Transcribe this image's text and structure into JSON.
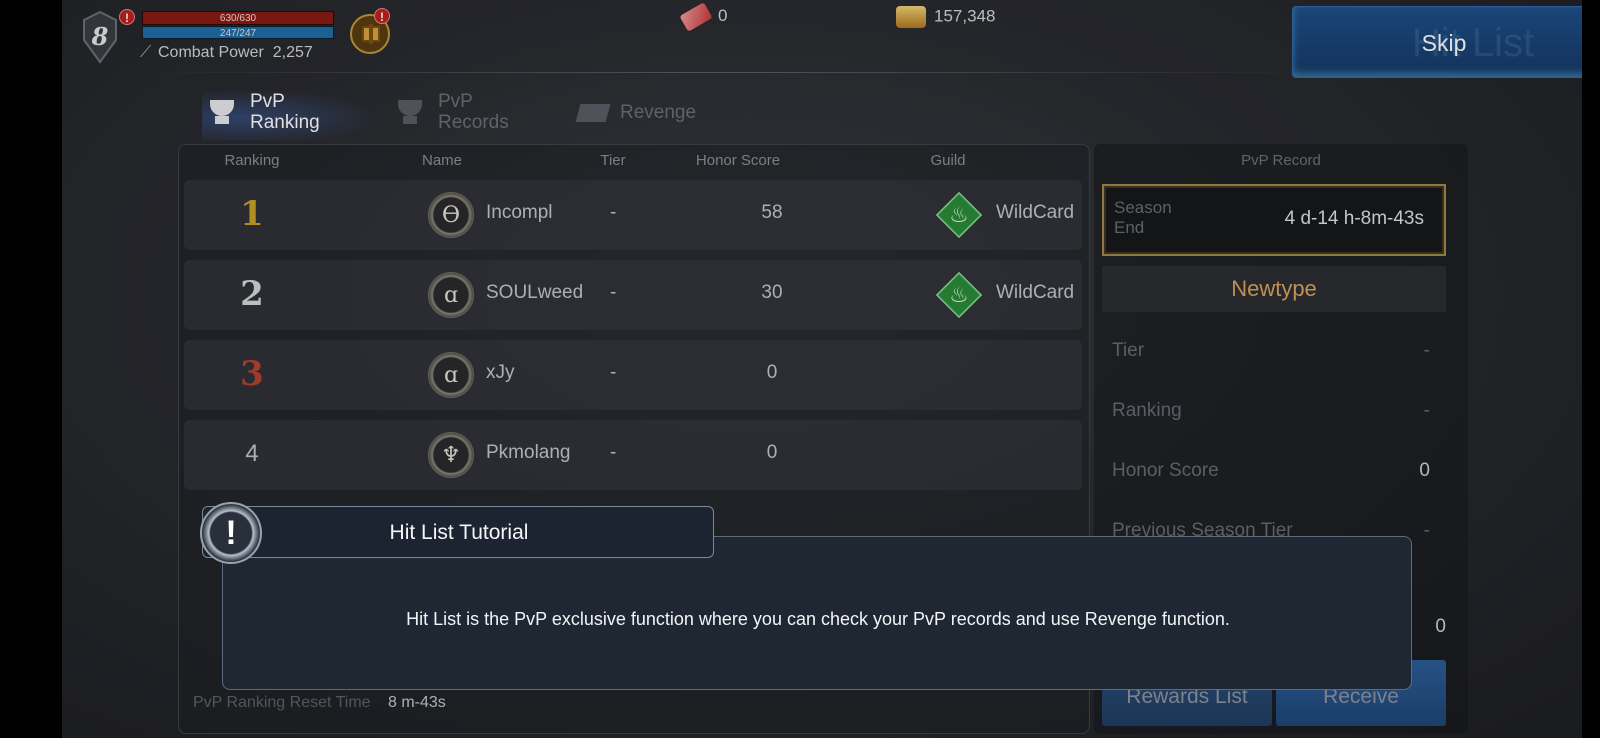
{
  "hud": {
    "level": "8",
    "hp": "630/630",
    "mp": "247/247",
    "combat_label": "Combat Power",
    "combat_value": "2,257",
    "alert": "!",
    "ticket_count": "0",
    "gold": "157,348",
    "skip_label": "Skip",
    "skip_shadow": "Hit List"
  },
  "tabs": [
    {
      "label_line1": "PvP",
      "label_line2": "Ranking",
      "active": true,
      "icon": "trophy-icon"
    },
    {
      "label_line1": "PvP",
      "label_line2": "Records",
      "active": false,
      "icon": "records-icon"
    },
    {
      "label_line1": "Revenge",
      "label_line2": "",
      "active": false,
      "icon": "revenge-icon"
    }
  ],
  "ranking": {
    "headers": {
      "ranking": "Ranking",
      "name": "Name",
      "tier": "Tier",
      "honor": "Honor Score",
      "guild": "Guild"
    },
    "rows": [
      {
        "rank": "1",
        "name": "Incompl",
        "tier": "-",
        "honor": "58",
        "guild": "WildCard",
        "emblem": "ϴ"
      },
      {
        "rank": "2",
        "name": "SOULweed",
        "tier": "-",
        "honor": "30",
        "guild": "WildCard",
        "emblem": "ɑ"
      },
      {
        "rank": "3",
        "name": "xJy",
        "tier": "-",
        "honor": "0",
        "guild": "",
        "emblem": "ɑ"
      },
      {
        "rank": "4",
        "name": "Pkmolang",
        "tier": "-",
        "honor": "0",
        "guild": "",
        "emblem": "♆"
      }
    ],
    "reset_label": "PvP Ranking Reset Time",
    "reset_value": "8 m-43s"
  },
  "record": {
    "title": "PvP Record",
    "season_label_1": "Season",
    "season_label_2": "End",
    "season_value": "4 d-14 h-8m-43s",
    "player_name": "Newtype",
    "stats": [
      {
        "label": "Tier",
        "value": "-"
      },
      {
        "label": "Ranking",
        "value": "-"
      },
      {
        "label": "Honor Score",
        "value": "0"
      },
      {
        "label": "Previous Season Tier",
        "value": "-"
      }
    ],
    "reward_count": "0",
    "rewards_list_label": "Rewards List",
    "receive_label": "Receive"
  },
  "tutorial": {
    "title": "Hit List Tutorial",
    "icon": "!",
    "text": "Hit List is the PvP exclusive function where you can check your PvP records and use Revenge function."
  },
  "colors": {
    "rank1": "#c9a227",
    "rank2": "#d7d8da",
    "rank3": "#b5452f",
    "accent_gold": "#d9a45f",
    "skip_blue": "#1f4f8a"
  }
}
